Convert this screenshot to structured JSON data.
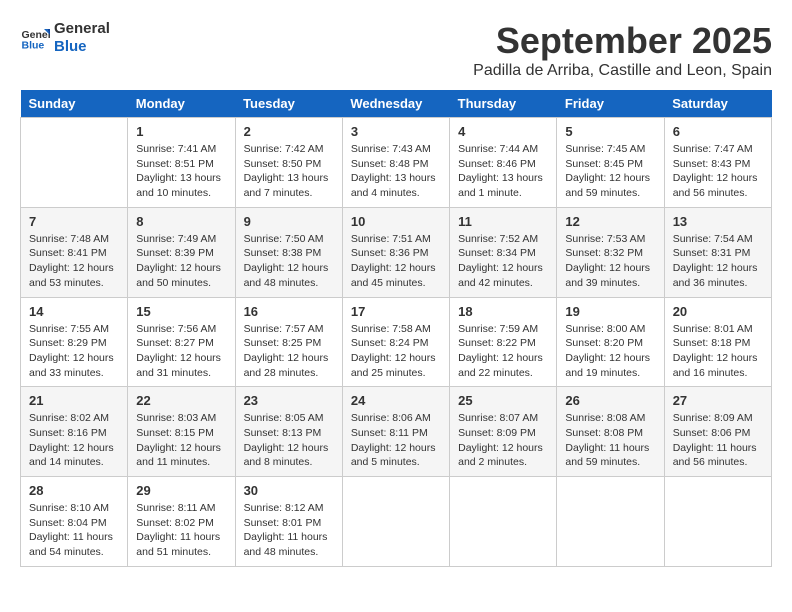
{
  "logo": {
    "line1": "General",
    "line2": "Blue"
  },
  "title": "September 2025",
  "subtitle": "Padilla de Arriba, Castille and Leon, Spain",
  "weekdays": [
    "Sunday",
    "Monday",
    "Tuesday",
    "Wednesday",
    "Thursday",
    "Friday",
    "Saturday"
  ],
  "weeks": [
    [
      {
        "day": "",
        "info": ""
      },
      {
        "day": "1",
        "info": "Sunrise: 7:41 AM\nSunset: 8:51 PM\nDaylight: 13 hours\nand 10 minutes."
      },
      {
        "day": "2",
        "info": "Sunrise: 7:42 AM\nSunset: 8:50 PM\nDaylight: 13 hours\nand 7 minutes."
      },
      {
        "day": "3",
        "info": "Sunrise: 7:43 AM\nSunset: 8:48 PM\nDaylight: 13 hours\nand 4 minutes."
      },
      {
        "day": "4",
        "info": "Sunrise: 7:44 AM\nSunset: 8:46 PM\nDaylight: 13 hours\nand 1 minute."
      },
      {
        "day": "5",
        "info": "Sunrise: 7:45 AM\nSunset: 8:45 PM\nDaylight: 12 hours\nand 59 minutes."
      },
      {
        "day": "6",
        "info": "Sunrise: 7:47 AM\nSunset: 8:43 PM\nDaylight: 12 hours\nand 56 minutes."
      }
    ],
    [
      {
        "day": "7",
        "info": "Sunrise: 7:48 AM\nSunset: 8:41 PM\nDaylight: 12 hours\nand 53 minutes."
      },
      {
        "day": "8",
        "info": "Sunrise: 7:49 AM\nSunset: 8:39 PM\nDaylight: 12 hours\nand 50 minutes."
      },
      {
        "day": "9",
        "info": "Sunrise: 7:50 AM\nSunset: 8:38 PM\nDaylight: 12 hours\nand 48 minutes."
      },
      {
        "day": "10",
        "info": "Sunrise: 7:51 AM\nSunset: 8:36 PM\nDaylight: 12 hours\nand 45 minutes."
      },
      {
        "day": "11",
        "info": "Sunrise: 7:52 AM\nSunset: 8:34 PM\nDaylight: 12 hours\nand 42 minutes."
      },
      {
        "day": "12",
        "info": "Sunrise: 7:53 AM\nSunset: 8:32 PM\nDaylight: 12 hours\nand 39 minutes."
      },
      {
        "day": "13",
        "info": "Sunrise: 7:54 AM\nSunset: 8:31 PM\nDaylight: 12 hours\nand 36 minutes."
      }
    ],
    [
      {
        "day": "14",
        "info": "Sunrise: 7:55 AM\nSunset: 8:29 PM\nDaylight: 12 hours\nand 33 minutes."
      },
      {
        "day": "15",
        "info": "Sunrise: 7:56 AM\nSunset: 8:27 PM\nDaylight: 12 hours\nand 31 minutes."
      },
      {
        "day": "16",
        "info": "Sunrise: 7:57 AM\nSunset: 8:25 PM\nDaylight: 12 hours\nand 28 minutes."
      },
      {
        "day": "17",
        "info": "Sunrise: 7:58 AM\nSunset: 8:24 PM\nDaylight: 12 hours\nand 25 minutes."
      },
      {
        "day": "18",
        "info": "Sunrise: 7:59 AM\nSunset: 8:22 PM\nDaylight: 12 hours\nand 22 minutes."
      },
      {
        "day": "19",
        "info": "Sunrise: 8:00 AM\nSunset: 8:20 PM\nDaylight: 12 hours\nand 19 minutes."
      },
      {
        "day": "20",
        "info": "Sunrise: 8:01 AM\nSunset: 8:18 PM\nDaylight: 12 hours\nand 16 minutes."
      }
    ],
    [
      {
        "day": "21",
        "info": "Sunrise: 8:02 AM\nSunset: 8:16 PM\nDaylight: 12 hours\nand 14 minutes."
      },
      {
        "day": "22",
        "info": "Sunrise: 8:03 AM\nSunset: 8:15 PM\nDaylight: 12 hours\nand 11 minutes."
      },
      {
        "day": "23",
        "info": "Sunrise: 8:05 AM\nSunset: 8:13 PM\nDaylight: 12 hours\nand 8 minutes."
      },
      {
        "day": "24",
        "info": "Sunrise: 8:06 AM\nSunset: 8:11 PM\nDaylight: 12 hours\nand 5 minutes."
      },
      {
        "day": "25",
        "info": "Sunrise: 8:07 AM\nSunset: 8:09 PM\nDaylight: 12 hours\nand 2 minutes."
      },
      {
        "day": "26",
        "info": "Sunrise: 8:08 AM\nSunset: 8:08 PM\nDaylight: 11 hours\nand 59 minutes."
      },
      {
        "day": "27",
        "info": "Sunrise: 8:09 AM\nSunset: 8:06 PM\nDaylight: 11 hours\nand 56 minutes."
      }
    ],
    [
      {
        "day": "28",
        "info": "Sunrise: 8:10 AM\nSunset: 8:04 PM\nDaylight: 11 hours\nand 54 minutes."
      },
      {
        "day": "29",
        "info": "Sunrise: 8:11 AM\nSunset: 8:02 PM\nDaylight: 11 hours\nand 51 minutes."
      },
      {
        "day": "30",
        "info": "Sunrise: 8:12 AM\nSunset: 8:01 PM\nDaylight: 11 hours\nand 48 minutes."
      },
      {
        "day": "",
        "info": ""
      },
      {
        "day": "",
        "info": ""
      },
      {
        "day": "",
        "info": ""
      },
      {
        "day": "",
        "info": ""
      }
    ]
  ]
}
